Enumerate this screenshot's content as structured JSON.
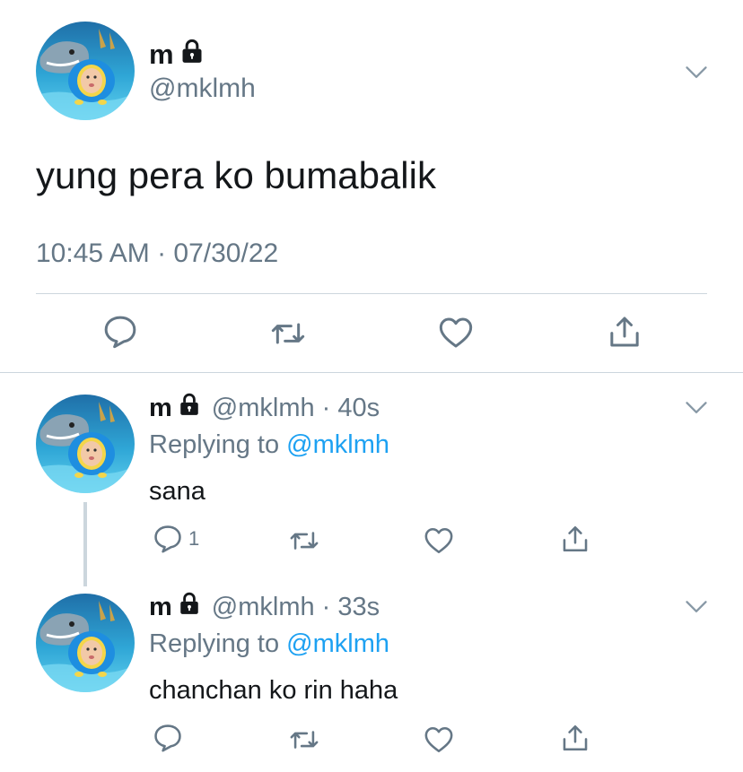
{
  "colors": {
    "text": "#14171a",
    "muted": "#657786",
    "accent": "#1da1f2",
    "divider": "#ccd6dd"
  },
  "main_tweet": {
    "display_name": "m",
    "handle": "@mklmh",
    "text": "yung pera ko bumabalik",
    "timestamp": "10:45 AM · 07/30/22",
    "icons": [
      "lock-icon",
      "chevron-down-icon",
      "reply-icon",
      "retweet-icon",
      "like-icon",
      "share-icon"
    ]
  },
  "replies": [
    {
      "display_name": "m",
      "handle_time": "@mklmh · 40s",
      "replying_prefix": "Replying to",
      "replying_to": "@mklmh",
      "text": "sana",
      "reply_count": "1"
    },
    {
      "display_name": "m",
      "handle_time": "@mklmh · 33s",
      "replying_prefix": "Replying to",
      "replying_to": "@mklmh",
      "text": "chanchan ko rin haha",
      "reply_count": ""
    }
  ]
}
